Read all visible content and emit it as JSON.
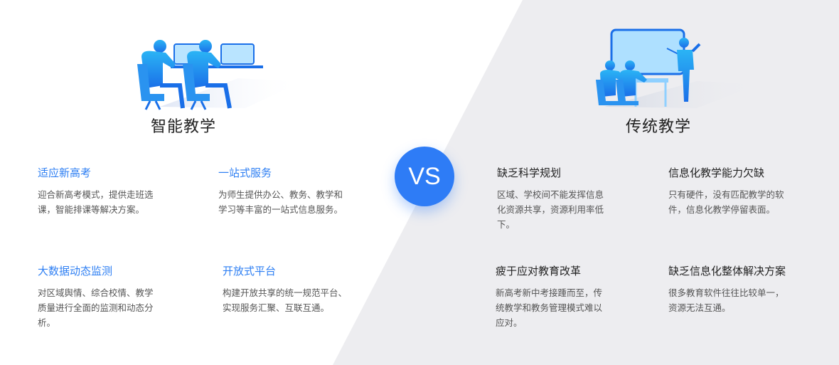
{
  "vs_label": "VS",
  "left": {
    "title": "智能教学",
    "features": [
      {
        "title": "适应新高考",
        "desc_lines": [
          "迎合新高考模式，提供走班选",
          "课，智能排课等解决方案。"
        ]
      },
      {
        "title": "一站式服务",
        "desc_lines": [
          "为师生提供办公、教务、教学和",
          "学习等丰富的一站式信息服务。"
        ]
      },
      {
        "title": "大数据动态监测",
        "desc_lines": [
          "对区域舆情、综合校情、教学",
          "质量进行全面的监测和动态分",
          "析。"
        ]
      },
      {
        "title": "开放式平台",
        "desc_lines": [
          "构建开放共享的统一规范平台、",
          "实现服务汇聚、互联互通。"
        ]
      }
    ]
  },
  "right": {
    "title": "传统教学",
    "features": [
      {
        "title": "缺乏科学规划",
        "desc_lines": [
          "区域、学校间不能发挥信息",
          "化资源共享，资源利用率低",
          "下。"
        ]
      },
      {
        "title": "信息化教学能力欠缺",
        "desc_lines": [
          "只有硬件，没有匹配教学的软",
          "件，信息化教学停留表面。"
        ]
      },
      {
        "title": "疲于应对教育改革",
        "desc_lines": [
          "新高考新中考接踵而至，传",
          "统教学和教务管理模式难以",
          "应对。"
        ]
      },
      {
        "title": "缺乏信息化整体解决方案",
        "desc_lines": [
          "很多教育软件往往比较单一，",
          "资源无法互通。"
        ]
      }
    ]
  },
  "illustrations": {
    "left": "students-at-computers-illustration",
    "right": "teacher-at-whiteboard-illustration"
  },
  "colors": {
    "accent": "#2e7cf6",
    "right_bg": "#ededf0",
    "left_bg": "#ffffff"
  }
}
